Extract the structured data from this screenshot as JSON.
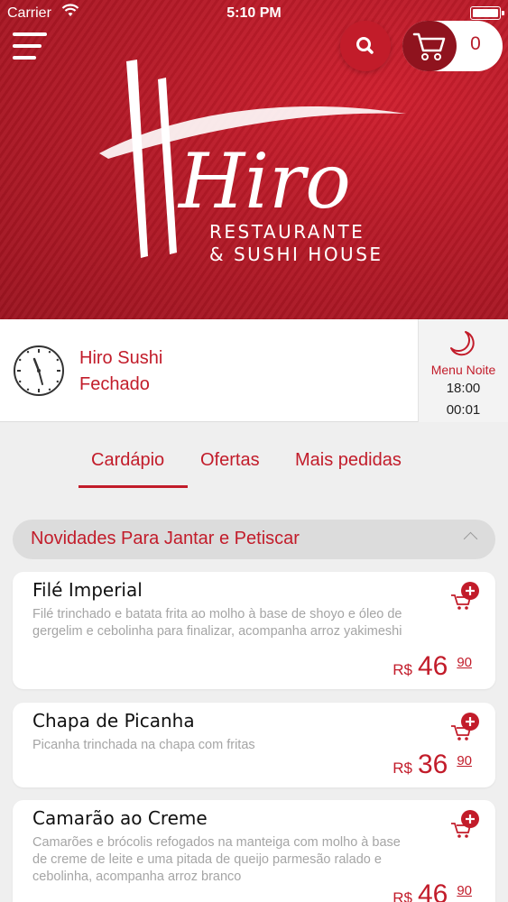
{
  "status_bar": {
    "carrier": "Carrier",
    "time": "5:10 PM"
  },
  "header": {
    "cart_count": "0"
  },
  "logo": {
    "brand": "Hiro",
    "line1": "RESTAURANTE",
    "line2": "& SUSHI HOUSE"
  },
  "store": {
    "name": "Hiro Sushi",
    "status": "Fechado",
    "menu_label": "Menu Noite",
    "open_time": "18:00",
    "close_time": "00:01"
  },
  "tabs": [
    {
      "label": "Cardápio",
      "active": true
    },
    {
      "label": "Ofertas",
      "active": false
    },
    {
      "label": "Mais pedidas",
      "active": false
    }
  ],
  "category": {
    "title": "Novidades Para Jantar e Petiscar"
  },
  "products": [
    {
      "name": "Filé Imperial",
      "description": "Filé trinchado e batata frita ao molho à base de shoyo e óleo de gergelim e cebolinha para finalizar, acompanha arroz yakimeshi",
      "currency": "R$",
      "price_int": "46",
      "price_dec": "90"
    },
    {
      "name": "Chapa de Picanha",
      "description": "Picanha trinchada na chapa com fritas",
      "currency": "R$",
      "price_int": "36",
      "price_dec": "90"
    },
    {
      "name": "Camarão ao Creme",
      "description": "Camarões e brócolis refogados na manteiga com molho à base de creme de leite e uma pitada de queijo parmesão ralado e cebolinha, acompanha arroz branco",
      "currency": "R$",
      "price_int": "46",
      "price_dec": "90"
    }
  ],
  "colors": {
    "brand_red": "#c21c2a",
    "dark_red": "#8f131e",
    "background": "#efefef"
  },
  "icons": [
    "menu-icon",
    "search-icon",
    "cart-icon",
    "clock-icon",
    "moon-icon",
    "add-to-cart-icon",
    "chevron-up-icon",
    "wifi-icon",
    "battery-icon"
  ]
}
